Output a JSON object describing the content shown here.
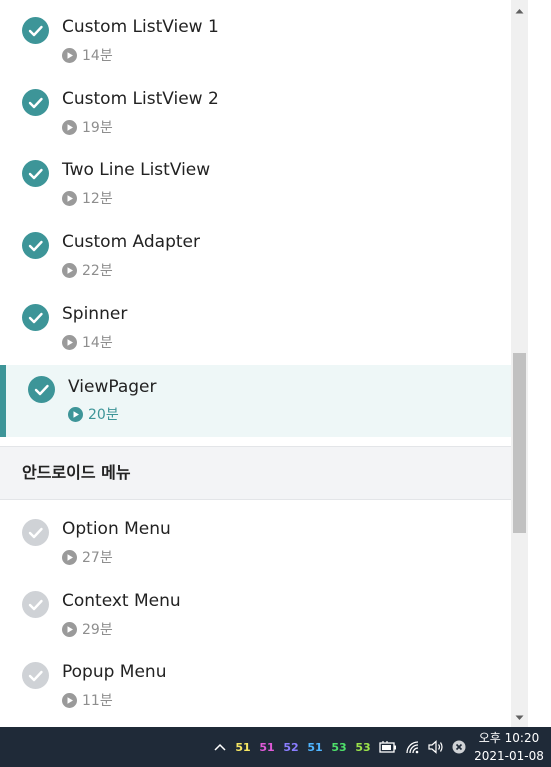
{
  "lessons_top": [
    {
      "title": "Custom ListView 1",
      "duration": "14분"
    },
    {
      "title": "Custom ListView 2",
      "duration": "19분"
    },
    {
      "title": "Two Line ListView",
      "duration": "12분"
    },
    {
      "title": "Custom Adapter",
      "duration": "22분"
    },
    {
      "title": "Spinner",
      "duration": "14분"
    },
    {
      "title": "ViewPager",
      "duration": "20분"
    }
  ],
  "section": {
    "title": "안드로이드 메뉴"
  },
  "lessons_bottom": [
    {
      "title": "Option Menu",
      "duration": "27분"
    },
    {
      "title": "Context Menu",
      "duration": "29분"
    },
    {
      "title": "Popup Menu",
      "duration": "11분"
    }
  ],
  "taskbar": {
    "tray_numbers": [
      {
        "value": "51",
        "color": "#f5e663"
      },
      {
        "value": "51",
        "color": "#e05ad8"
      },
      {
        "value": "52",
        "color": "#8a7dff"
      },
      {
        "value": "51",
        "color": "#4fb5ff"
      },
      {
        "value": "53",
        "color": "#4ee06a"
      },
      {
        "value": "53",
        "color": "#9be34a"
      }
    ],
    "clock_time": "오후 10:20",
    "clock_date": "2021-01-08"
  },
  "colors": {
    "accent": "#3d9598",
    "completed_check": "#3d9598",
    "pending_check": "#cfd2d6"
  },
  "icons": {
    "done": "check-circle-icon",
    "pending": "check-circle-outline-icon",
    "play": "play-circle-icon"
  }
}
